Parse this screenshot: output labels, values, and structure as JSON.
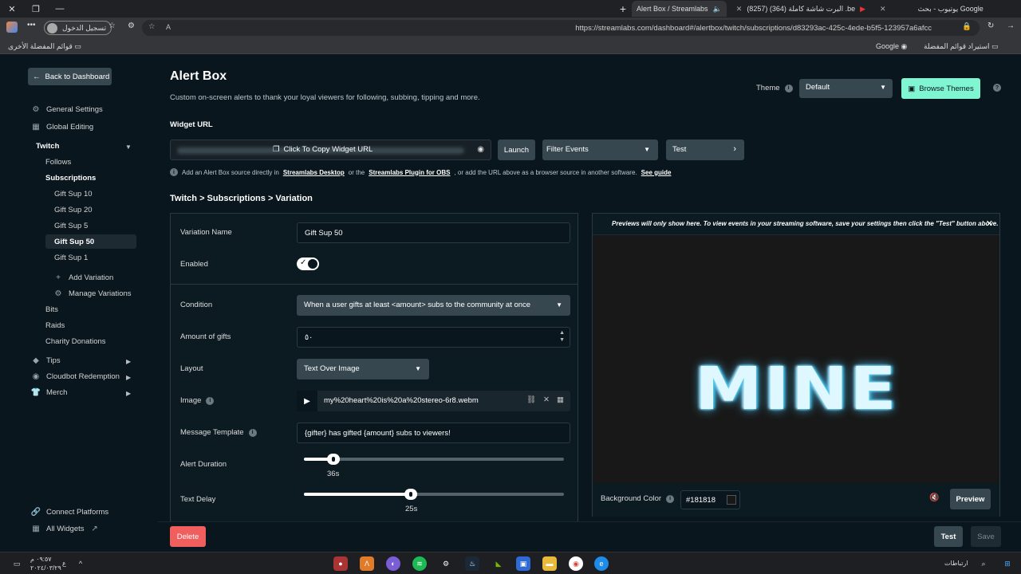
{
  "browser": {
    "tabs": [
      {
        "label": "Alert Box / Streamlabs",
        "active": true
      },
      {
        "label": "(8257) البرت شاشة كاملة (364) .be",
        "active": false
      },
      {
        "label": "يوتيوب - بحث Google",
        "active": false
      }
    ],
    "profile_label": "تسجيل الدخول",
    "url": "https://streamlabs.com/dashboard#/alertbox/twitch/subscriptions/d83293ac-425c-4ede-b5f5-123957a6afcc",
    "bookmarks": {
      "other_favorites": "قوائم المفضلة الأخرى",
      "google": "Google",
      "import_favorites": "استيراد قوائم المفضلة"
    }
  },
  "sidebar": {
    "back_label": "Back to Dashboard",
    "general_settings": "General Settings",
    "global_editing": "Global Editing",
    "twitch": "Twitch",
    "follows": "Follows",
    "subscriptions": "Subscriptions",
    "variations": [
      "Gift Sup 10",
      "Gift Sup 20",
      "Gift Sup 5",
      "Gift Sup 50",
      "Gift Sup 1"
    ],
    "selected_variation": "Gift Sup 50",
    "add_variation": "Add Variation",
    "manage_variations": "Manage Variations",
    "bits": "Bits",
    "raids": "Raids",
    "charity_donations": "Charity Donations",
    "tips": "Tips",
    "cloudbot_redemption": "Cloudbot Redemption",
    "merch": "Merch",
    "connect_platforms": "Connect Platforms",
    "all_widgets": "All Widgets"
  },
  "header": {
    "title": "Alert Box",
    "description": "Custom on-screen alerts to thank your loyal viewers for following, subbing, tipping and more.",
    "theme_label": "Theme",
    "theme_value": "Default",
    "browse_themes": "Browse Themes"
  },
  "widget": {
    "url_label": "Widget URL",
    "copy_label": "Click To Copy Widget URL",
    "launch": "Launch",
    "filter_events": "Filter Events",
    "test": "Test",
    "note_1": "Add an Alert Box source directly in",
    "note_link_1": "Streamlabs Desktop",
    "note_2": "or the",
    "note_link_2": "Streamlabs Plugin for OBS",
    "note_3": ", or add the URL above as a browser source in another software.",
    "note_link_3": "See guide"
  },
  "breadcrumb": "Twitch > Subscriptions > Variation",
  "form": {
    "variation_name_label": "Variation Name",
    "variation_name_value": "Gift Sup 50",
    "enabled_label": "Enabled",
    "enabled": true,
    "condition_label": "Condition",
    "condition_value": "When a user gifts at least <amount> subs to the community at once",
    "amount_label": "Amount of gifts",
    "amount_value": "٥٠",
    "layout_label": "Layout",
    "layout_value": "Text Over Image",
    "image_label": "Image",
    "image_value": "my%20heart%20is%20a%20stereo-6r8.webm",
    "message_label": "Message Template",
    "message_value": "{gifter} has gifted {amount} subs to viewers!",
    "alert_duration_label": "Alert Duration",
    "alert_duration_value": "36s",
    "alert_duration_fraction": 0.115,
    "text_delay_label": "Text Delay",
    "text_delay_value": "25s",
    "text_delay_fraction": 0.41
  },
  "preview": {
    "message": "Previews will only show here. To view events in your streaming software, save your settings then click the \"Test\" button above.",
    "alert_text": "MINE",
    "bg_color_label": "Background Color",
    "bg_color_value": "#181818",
    "preview_button": "Preview"
  },
  "footer": {
    "delete": "Delete",
    "test": "Test",
    "save": "Save"
  },
  "taskbar": {
    "time": "٠٩:٥٧ م",
    "date": "٢٠٢٤/٠٣/٢٩",
    "lang": "ع",
    "network_label": "ارتباطات"
  },
  "colors": {
    "background": "#09161d",
    "accent": "#80f5d2",
    "danger": "#f05e5e",
    "button": "#37474f"
  }
}
